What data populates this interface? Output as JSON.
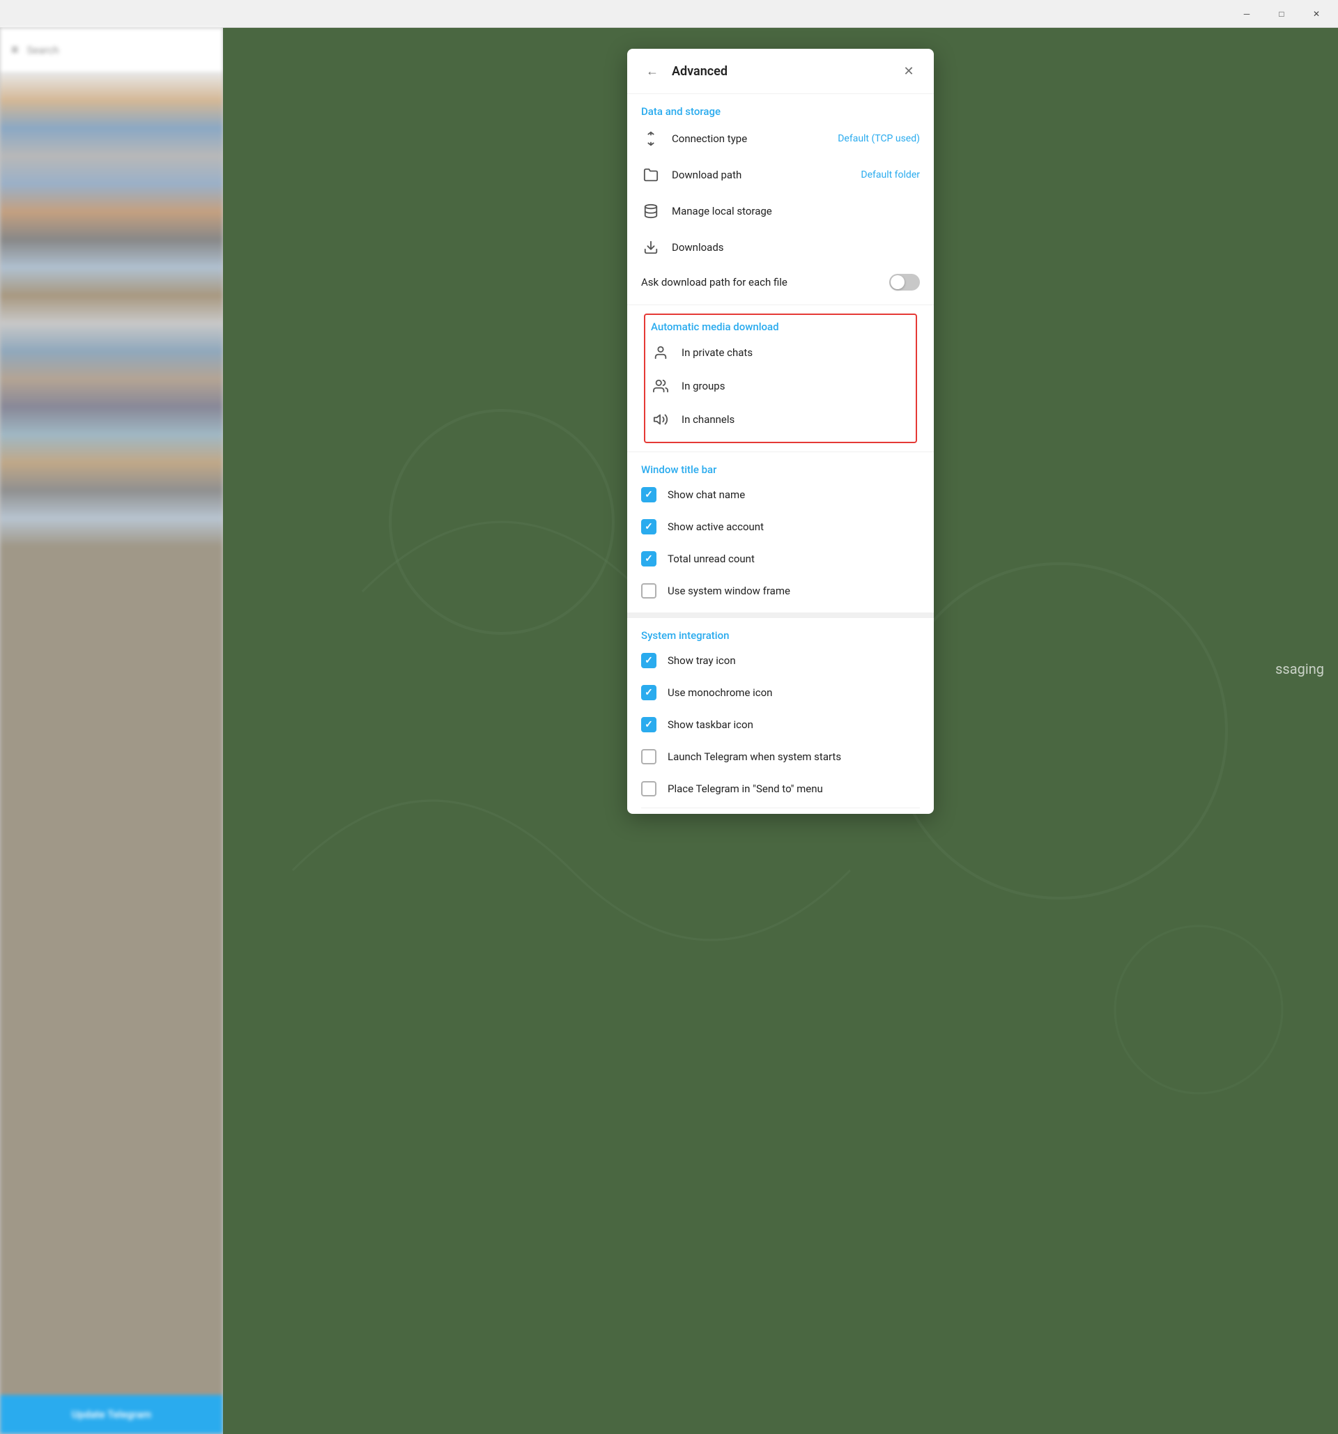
{
  "window": {
    "min_label": "─",
    "max_label": "□",
    "close_label": "✕"
  },
  "sidebar": {
    "search_placeholder": "Search",
    "hamburger_icon": "≡",
    "update_btn_label": "Update Telegram"
  },
  "dialog": {
    "title": "Advanced",
    "back_icon": "←",
    "close_icon": "✕",
    "sections": {
      "data_storage": {
        "title": "Data and storage",
        "connection_type": {
          "label": "Connection type",
          "value": "Default (TCP used)"
        },
        "download_path": {
          "label": "Download path",
          "value": "Default folder"
        },
        "manage_local_storage": {
          "label": "Manage local storage"
        },
        "downloads": {
          "label": "Downloads"
        },
        "ask_download_path": {
          "label": "Ask download path for each file",
          "enabled": false
        }
      },
      "auto_media_download": {
        "title": "Automatic media download",
        "items": [
          {
            "label": "In private chats"
          },
          {
            "label": "In groups"
          },
          {
            "label": "In channels"
          }
        ]
      },
      "window_title_bar": {
        "title": "Window title bar",
        "items": [
          {
            "label": "Show chat name",
            "checked": true
          },
          {
            "label": "Show active account",
            "checked": true
          },
          {
            "label": "Total unread count",
            "checked": true
          },
          {
            "label": "Use system window frame",
            "checked": false
          }
        ]
      },
      "system_integration": {
        "title": "System integration",
        "items": [
          {
            "label": "Show tray icon",
            "checked": true
          },
          {
            "label": "Use monochrome icon",
            "checked": true
          },
          {
            "label": "Show taskbar icon",
            "checked": true
          },
          {
            "label": "Launch Telegram when system starts",
            "checked": false
          },
          {
            "label": "Place Telegram in \"Send to\" menu",
            "checked": false
          }
        ]
      }
    }
  },
  "bg_text": "ssaging"
}
